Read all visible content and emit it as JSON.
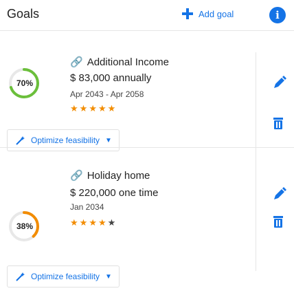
{
  "header": {
    "title": "Goals",
    "add_goal_label": "Add goal",
    "info_icon": "info-icon"
  },
  "goals": [
    {
      "name": "Additional Income",
      "amount": "$ 83,000 annually",
      "dates": "Apr 2043 - Apr 2058",
      "feasibility": "70%",
      "feasibility_value": 0.7,
      "stars_filled": 5,
      "stars_total": 5,
      "optimize_label": "Optimize feasibility",
      "icons": [
        "link-icon",
        "edit-icon",
        "delete-icon"
      ]
    },
    {
      "name": "Holiday home",
      "amount": "$ 220,000 one time",
      "dates": "Jan 2034",
      "feasibility": "38%",
      "feasibility_value": 0.38,
      "stars_filled": 4,
      "stars_total": 5,
      "optimize_label": "Optimize feasibility",
      "icons": [
        "link-icon",
        "edit-icon",
        "delete-icon"
      ]
    }
  ],
  "colors": {
    "accent": "#1473e6",
    "ring_high": "#6bbf3b",
    "ring_low": "#f28c00",
    "stars": "#f28c00"
  }
}
